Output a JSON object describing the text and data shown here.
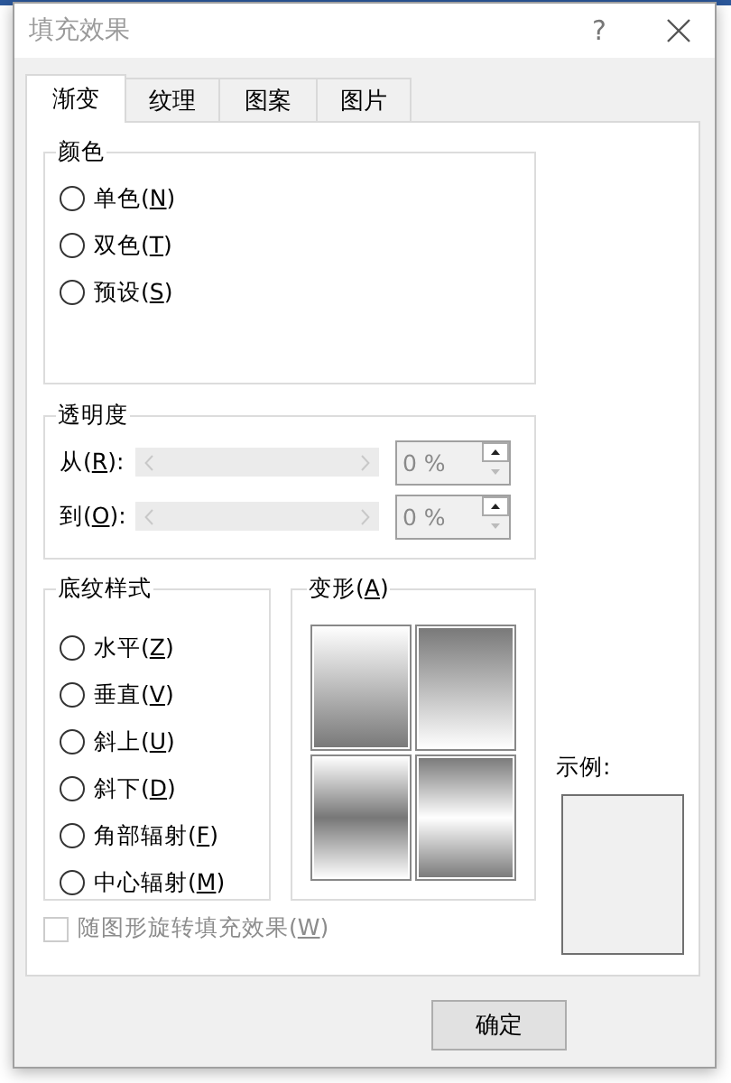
{
  "window": {
    "title": "填充效果",
    "help_label": "?"
  },
  "tabs": [
    {
      "label": "渐变",
      "selected": true
    },
    {
      "label": "纹理",
      "selected": false
    },
    {
      "label": "图案",
      "selected": false
    },
    {
      "label": "图片",
      "selected": false
    }
  ],
  "colors": {
    "title": "颜色",
    "options": [
      {
        "label": "单色(N)",
        "selected": false
      },
      {
        "label": "双色(T)",
        "selected": false
      },
      {
        "label": "预设(S)",
        "selected": false
      }
    ]
  },
  "transparency": {
    "title": "透明度",
    "rows": [
      {
        "label": "从(R):",
        "value": "0 %",
        "disabled": true
      },
      {
        "label": "到(O):",
        "value": "0 %",
        "disabled": true
      }
    ]
  },
  "shading_styles": {
    "title": "底纹样式",
    "options": [
      {
        "label": "水平(Z)",
        "selected": false
      },
      {
        "label": "垂直(V)",
        "selected": false
      },
      {
        "label": "斜上(U)",
        "selected": false
      },
      {
        "label": "斜下(D)",
        "selected": false
      },
      {
        "label": "角部辐射(F)",
        "selected": false
      },
      {
        "label": "中心辐射(M)",
        "selected": false
      }
    ]
  },
  "variants": {
    "title": "变形(A)",
    "items": [
      {
        "kind": "light-to-dark"
      },
      {
        "kind": "dark-to-light"
      },
      {
        "kind": "dark-center"
      },
      {
        "kind": "light-center"
      }
    ]
  },
  "sample": {
    "label": "示例:"
  },
  "rotate_with_shape": {
    "label": "随图形旋转填充效果(W)",
    "checked": false,
    "disabled": true
  },
  "buttons": [
    "确定"
  ]
}
